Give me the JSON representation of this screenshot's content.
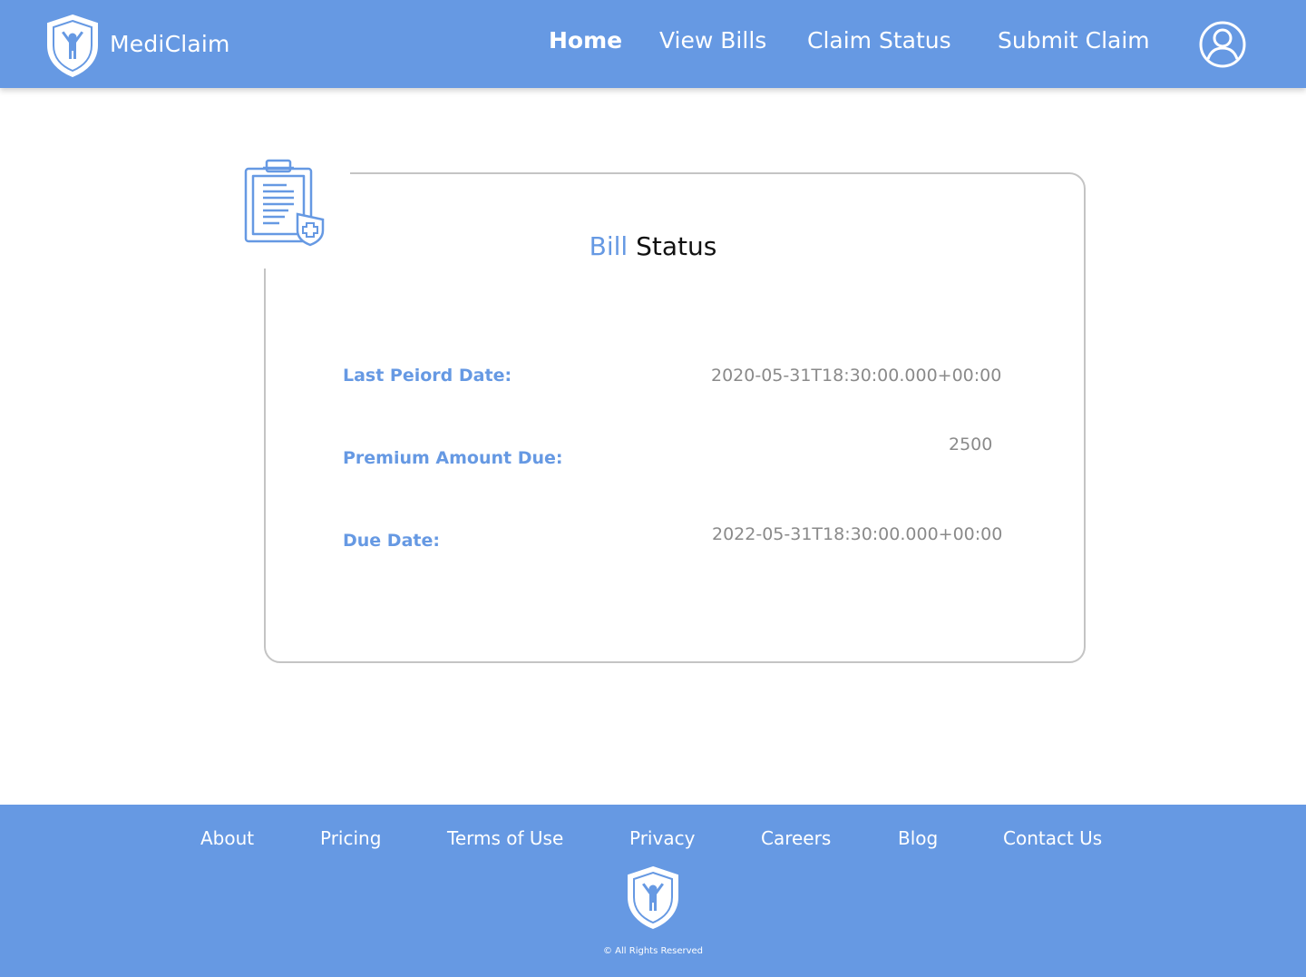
{
  "header": {
    "brand": "MediClaim",
    "nav": [
      {
        "label": "Home",
        "active": true
      },
      {
        "label": "View Bills",
        "active": false
      },
      {
        "label": "Claim Status",
        "active": false
      },
      {
        "label": "Submit Claim",
        "active": false
      }
    ],
    "profile_icon": "user-circle-icon"
  },
  "card": {
    "icon": "clipboard-medical-icon",
    "title_part1": "Bill",
    "title_part2": "Status",
    "rows": [
      {
        "label": "Last Peiord Date:",
        "value": "2020-05-31T18:30:00.000+00:00"
      },
      {
        "label": "Premium Amount Due:",
        "value": "2500"
      },
      {
        "label": "Due Date:",
        "value": "2022-05-31T18:30:00.000+00:00"
      }
    ]
  },
  "footer": {
    "links": [
      "About",
      "Pricing",
      "Terms of Use",
      "Privacy",
      "Careers",
      "Blog",
      "Contact Us"
    ],
    "logo": "shield-person-logo",
    "copyright": "© All Rights Reserved"
  },
  "colors": {
    "primary": "#6699e3",
    "label": "#6699e3",
    "value": "#8a8a8a",
    "border": "#c4c4c4"
  }
}
